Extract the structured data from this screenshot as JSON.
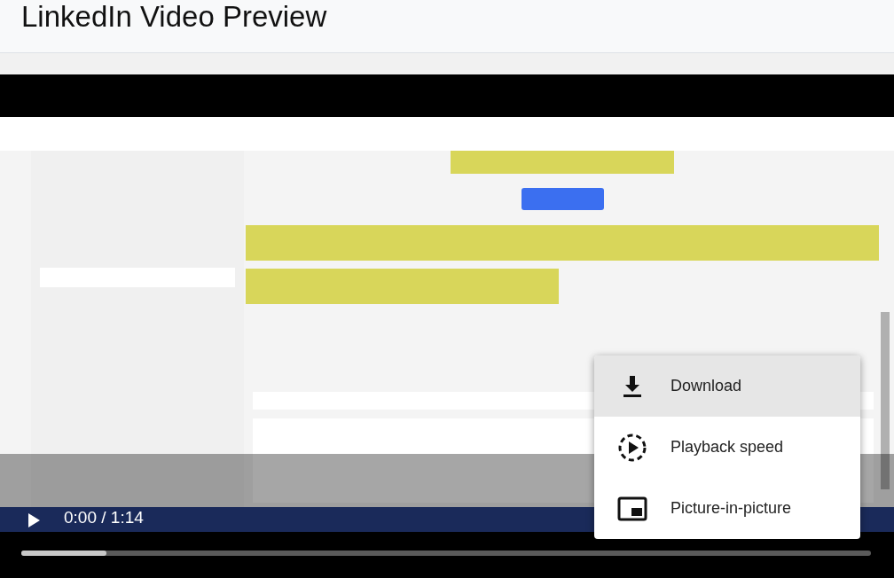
{
  "header": {
    "title": "LinkedIn Video Preview"
  },
  "video": {
    "playing": false,
    "time": "0:00 / 1:14",
    "progress": {
      "level": 0.1
    }
  },
  "menu": {
    "items": [
      {
        "label": "Download",
        "kind": "download",
        "selected": true
      },
      {
        "label": "Playback speed",
        "kind": "speed",
        "selected": false
      },
      {
        "label": "Picture-in-picture",
        "kind": "pip",
        "selected": false
      }
    ]
  }
}
